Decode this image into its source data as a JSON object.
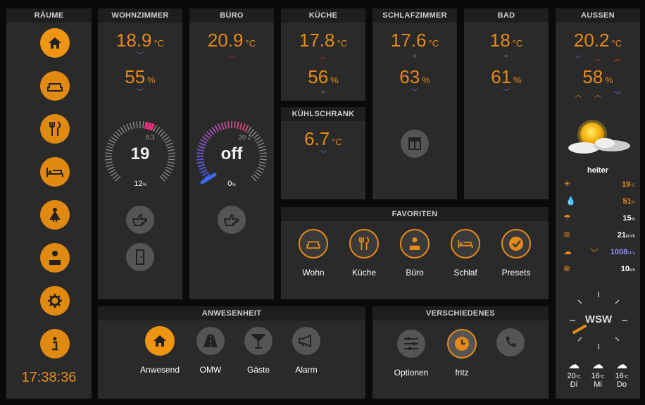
{
  "colors": {
    "accent": "#e68a17",
    "panel": "#2a2a2a",
    "header": "#1e1e1e",
    "blue": "#6a6ae0",
    "red": "#e03030"
  },
  "raeume": {
    "title": "RÄUME",
    "icons": [
      "home-icon",
      "sofa-icon",
      "dining-icon",
      "bed-icon",
      "woman-icon",
      "office-person-icon",
      "gear-icon",
      "info-icon"
    ],
    "time": "17:38:36"
  },
  "wohnzimmer": {
    "title": "WOHNZIMMER",
    "temp": "18.9",
    "temp_unit": "°C",
    "hum": "55",
    "hum_unit": "%",
    "dial_value": "19",
    "dial_target": "8.3",
    "dial_sub": "12",
    "dial_sub_unit": "%"
  },
  "buero": {
    "title": "BÜRO",
    "temp": "20.9",
    "temp_unit": "°C",
    "dial_value": "off",
    "dial_target": "20.2",
    "dial_sub": "0",
    "dial_sub_unit": "%"
  },
  "kueche": {
    "title": "KÜCHE",
    "temp": "17.8",
    "temp_unit": "°C",
    "hum": "56",
    "hum_unit": "%"
  },
  "kuehlschrank": {
    "title": "KÜHLSCHRANK",
    "temp": "6.7",
    "temp_unit": "°C"
  },
  "schlafzimmer": {
    "title": "SCHLAFZIMMER",
    "temp": "17.6",
    "temp_unit": "°C",
    "hum": "63",
    "hum_unit": "%"
  },
  "bad": {
    "title": "BAD",
    "temp": "18",
    "temp_unit": "°C",
    "hum": "61",
    "hum_unit": "%"
  },
  "aussen": {
    "title": "AUSSEN",
    "temp": "20.2",
    "temp_unit": "°C",
    "hum": "58",
    "hum_unit": "%",
    "condition": "heiter",
    "rows": [
      {
        "icon": "sun-small-icon",
        "value": "19",
        "unit": "°C"
      },
      {
        "icon": "drop-icon",
        "value": "51",
        "unit": "%"
      },
      {
        "icon": "cloud-rain-icon",
        "value": "15",
        "unit": "%"
      },
      {
        "icon": "wind-icon",
        "value": "21",
        "unit": "km/h"
      },
      {
        "icon": "pressure-cloud-icon",
        "value": "1008",
        "unit": "hPa"
      },
      {
        "icon": "binoculars-icon",
        "value": "10",
        "unit": "km"
      }
    ],
    "wind_dir": "WSW",
    "forecast": [
      {
        "temp": "20",
        "unit": "°C",
        "day": "Di"
      },
      {
        "temp": "16",
        "unit": "°C",
        "day": "Mi"
      },
      {
        "temp": "16",
        "unit": "°C",
        "day": "Do"
      }
    ]
  },
  "favoriten": {
    "title": "FAVORITEN",
    "items": [
      {
        "label": "Wohn",
        "icon": "sofa-icon"
      },
      {
        "label": "Küche",
        "icon": "dining-icon"
      },
      {
        "label": "Büro",
        "icon": "office-person-icon"
      },
      {
        "label": "Schlaf",
        "icon": "bed-icon"
      },
      {
        "label": "Presets",
        "icon": "check-icon"
      }
    ]
  },
  "anwesenheit": {
    "title": "ANWESENHEIT",
    "items": [
      {
        "label": "Anwesend",
        "icon": "home-icon"
      },
      {
        "label": "OMW",
        "icon": "road-icon"
      },
      {
        "label": "Gäste",
        "icon": "cocktail-icon"
      },
      {
        "label": "Alarm",
        "icon": "megaphone-icon"
      }
    ]
  },
  "verschiedenes": {
    "title": "VERSCHIEDENES",
    "items": [
      {
        "label": "Optionen",
        "icon": "sliders-icon"
      },
      {
        "label": "fritz",
        "icon": "clock-icon"
      },
      {
        "label": "",
        "icon": "phone-icon"
      }
    ]
  }
}
